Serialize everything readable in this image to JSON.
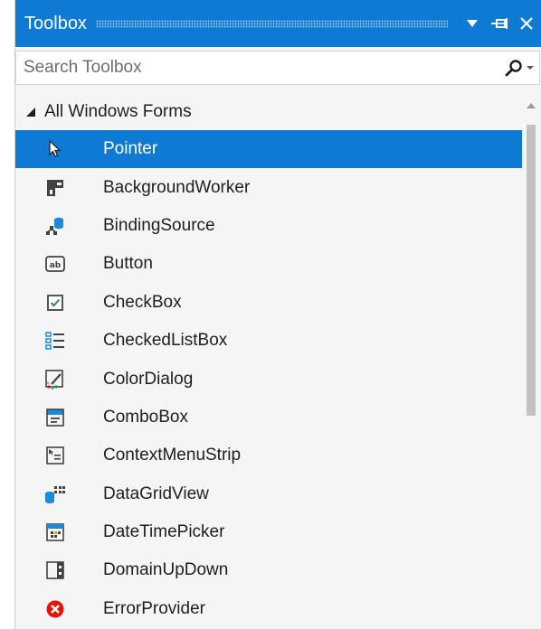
{
  "window": {
    "title": "Toolbox"
  },
  "search": {
    "placeholder": "Search Toolbox"
  },
  "group": {
    "label": "All Windows Forms",
    "expanded": true
  },
  "items": [
    {
      "label": "Pointer",
      "icon": "pointer-icon",
      "selected": true
    },
    {
      "label": "BackgroundWorker",
      "icon": "background-worker-icon"
    },
    {
      "label": "BindingSource",
      "icon": "binding-source-icon"
    },
    {
      "label": "Button",
      "icon": "button-icon"
    },
    {
      "label": "CheckBox",
      "icon": "checkbox-icon"
    },
    {
      "label": "CheckedListBox",
      "icon": "checked-list-box-icon"
    },
    {
      "label": "ColorDialog",
      "icon": "color-dialog-icon"
    },
    {
      "label": "ComboBox",
      "icon": "combo-box-icon"
    },
    {
      "label": "ContextMenuStrip",
      "icon": "context-menu-strip-icon"
    },
    {
      "label": "DataGridView",
      "icon": "data-grid-view-icon"
    },
    {
      "label": "DateTimePicker",
      "icon": "date-time-picker-icon"
    },
    {
      "label": "DomainUpDown",
      "icon": "domain-up-down-icon"
    },
    {
      "label": "ErrorProvider",
      "icon": "error-provider-icon"
    }
  ],
  "colors": {
    "accent": "#0e7ad3",
    "background": "#f5f5f5",
    "text": "#1e1e1e",
    "error": "#e51400",
    "icon_blue": "#1a8ad9",
    "icon_dark": "#424242"
  }
}
